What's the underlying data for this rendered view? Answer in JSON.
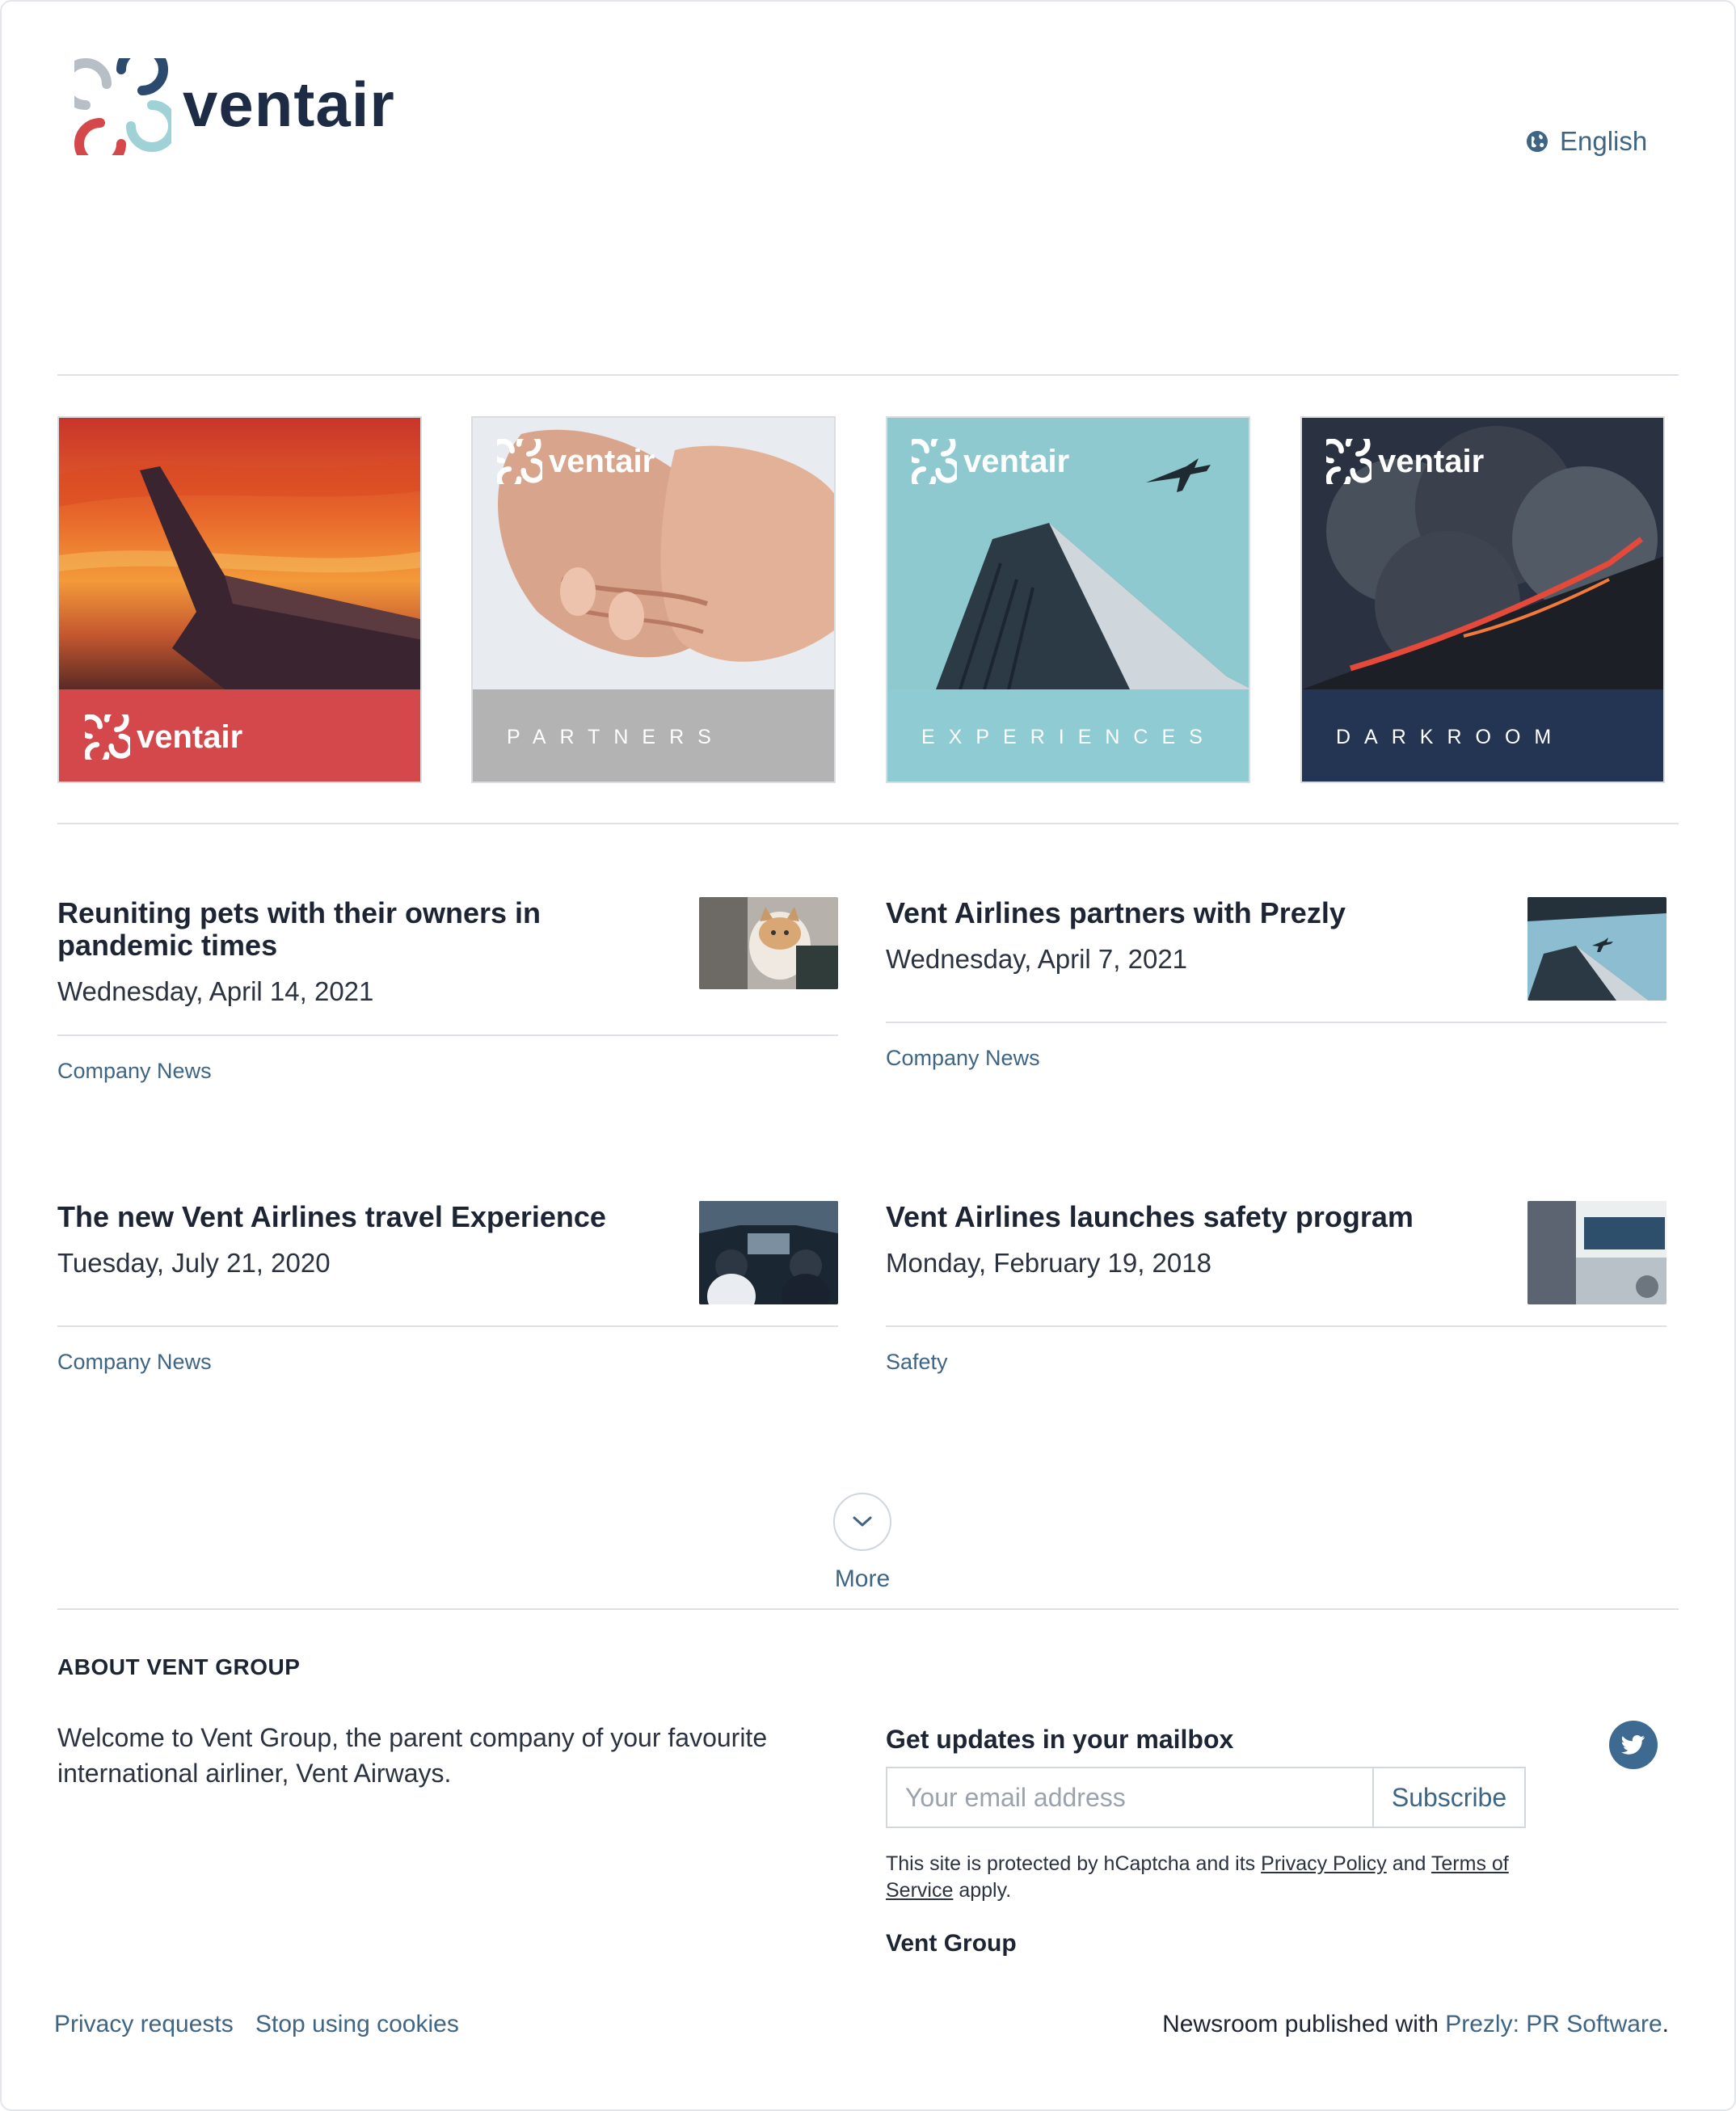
{
  "header": {
    "brand": "ventair",
    "language": "English",
    "icons": {
      "logo": "ventair-logo",
      "language": "globe-icon"
    }
  },
  "tiles": [
    {
      "label": "ventair",
      "band_color": "#d4474b",
      "image": "airplane-wing-sunset"
    },
    {
      "label": "PARTNERS",
      "overlay": "ventair",
      "band_color": "#b3b3b3",
      "image": "handshake"
    },
    {
      "label": "EXPERIENCES",
      "overlay": "ventair",
      "band_color": "#8fcbd3",
      "image": "skyscraper-airplane"
    },
    {
      "label": "DARKROOM",
      "overlay": "ventair",
      "band_color": "#243554",
      "image": "volcano-smoke"
    }
  ],
  "news": [
    {
      "title": "Reuniting pets with their owners in pandemic times",
      "date": "Wednesday, April 14, 2021",
      "category": "Company News",
      "image": "cat-photo"
    },
    {
      "title": "Vent Airlines partners with Prezly",
      "date": "Wednesday, April 7, 2021",
      "category": "Company News",
      "image": "building-airplane-photo"
    },
    {
      "title": "The new Vent Airlines travel Experience",
      "date": "Tuesday, July 21, 2020",
      "category": "Company News",
      "image": "cockpit-photo"
    },
    {
      "title": "Vent Airlines launches safety program",
      "date": "Monday, February 19, 2018",
      "category": "Safety",
      "image": "safety-card-photo"
    }
  ],
  "more": {
    "label": "More",
    "icon": "chevron-down-icon"
  },
  "about": {
    "heading": "ABOUT VENT GROUP",
    "text": "Welcome to Vent Group, the parent company of your favourite international airliner, Vent Airways."
  },
  "subscribe": {
    "heading": "Get updates in your mailbox",
    "placeholder": "Your email address",
    "button": "Subscribe",
    "captcha_prefix": "This site is protected by hCaptcha and its",
    "privacy_link": "Privacy Policy",
    "and": "and",
    "terms_link": "Terms of Service",
    "apply": "apply.",
    "company": "Vent Group",
    "social_icon": "twitter-icon"
  },
  "footer": {
    "privacy_requests": "Privacy requests",
    "stop_cookies": "Stop using cookies",
    "published_prefix": "Newsroom published with",
    "prezly_link": "Prezly: PR Software",
    "published_suffix": "."
  },
  "colors": {
    "accent": "#3f6585",
    "red": "#d4474b",
    "navy": "#1d2b45"
  }
}
